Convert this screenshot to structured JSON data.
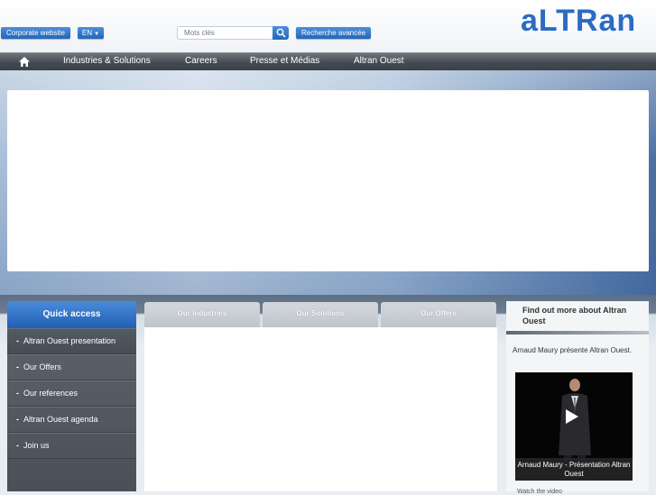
{
  "header": {
    "corporate_button": "Corporate website",
    "language": "EN",
    "search_placeholder": "Mots clés",
    "advanced_search": "Recherche avancée",
    "logo_text": "aLTRan",
    "brand_color": "#2a6cc4"
  },
  "nav": {
    "home_icon": "home-icon",
    "items": [
      {
        "label": "Industries & Solutions"
      },
      {
        "label": "Careers"
      },
      {
        "label": "Presse et Médias"
      },
      {
        "label": "Altran Ouest"
      }
    ]
  },
  "quick_access": {
    "title": "Quick access",
    "items": [
      {
        "label": "Altran Ouest presentation"
      },
      {
        "label": "Our Offers"
      },
      {
        "label": "Our references"
      },
      {
        "label": "Altran Ouest agenda"
      },
      {
        "label": "Join us"
      }
    ]
  },
  "tabs": [
    {
      "label": "Our Industries"
    },
    {
      "label": "Our Solutions"
    },
    {
      "label": "Our Offers"
    }
  ],
  "find_out": {
    "title": "Find out more about Altran Ouest",
    "caption": "Arnaud Maury présente Altran Ouest.",
    "video_title": "Arnaud Maury - Présentation Altran Ouest",
    "watch_link": "Watch the video"
  }
}
